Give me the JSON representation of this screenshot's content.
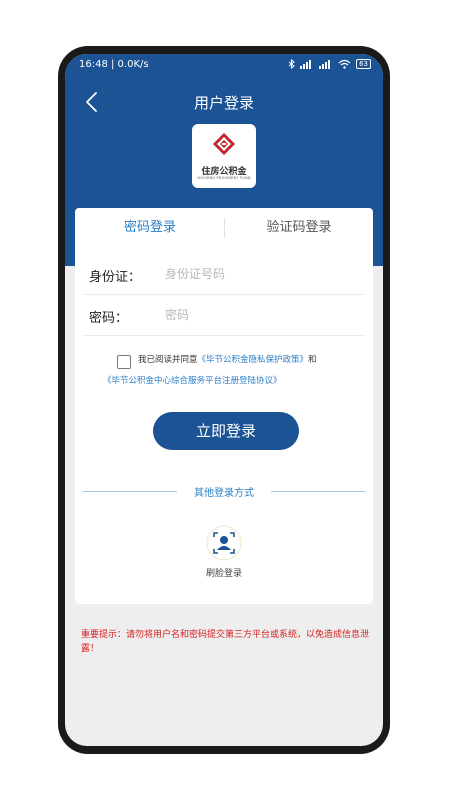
{
  "status_bar": {
    "time_info": "16:48 | 0.0K/s",
    "battery": "63"
  },
  "header": {
    "title": "用户登录"
  },
  "logo": {
    "text": "住房公积金",
    "subtext": "HOUSING PROVIDENT FUND"
  },
  "tabs": [
    {
      "label": "密码登录",
      "active": true
    },
    {
      "label": "验证码登录",
      "active": false
    }
  ],
  "form": {
    "id_label": "身份证：",
    "id_placeholder": "身份证号码",
    "password_label": "密码：",
    "password_placeholder": "密码"
  },
  "agreement": {
    "prefix": "我已阅读并同意",
    "privacy_link": "《毕节公积金隐私保护政策》",
    "and": "和",
    "service_link": "《毕节公积金中心综合服务平台注册登陆协议》"
  },
  "login_button": "立即登录",
  "other_methods": {
    "title": "其他登录方式",
    "face_login": "刷脸登录"
  },
  "notice": "重要提示：请勿将用户名和密码提交第三方平台或系统，以免造成信息泄露！",
  "colors": {
    "primary": "#1c5394",
    "link": "#2a7ec8",
    "warning": "#d62020"
  }
}
